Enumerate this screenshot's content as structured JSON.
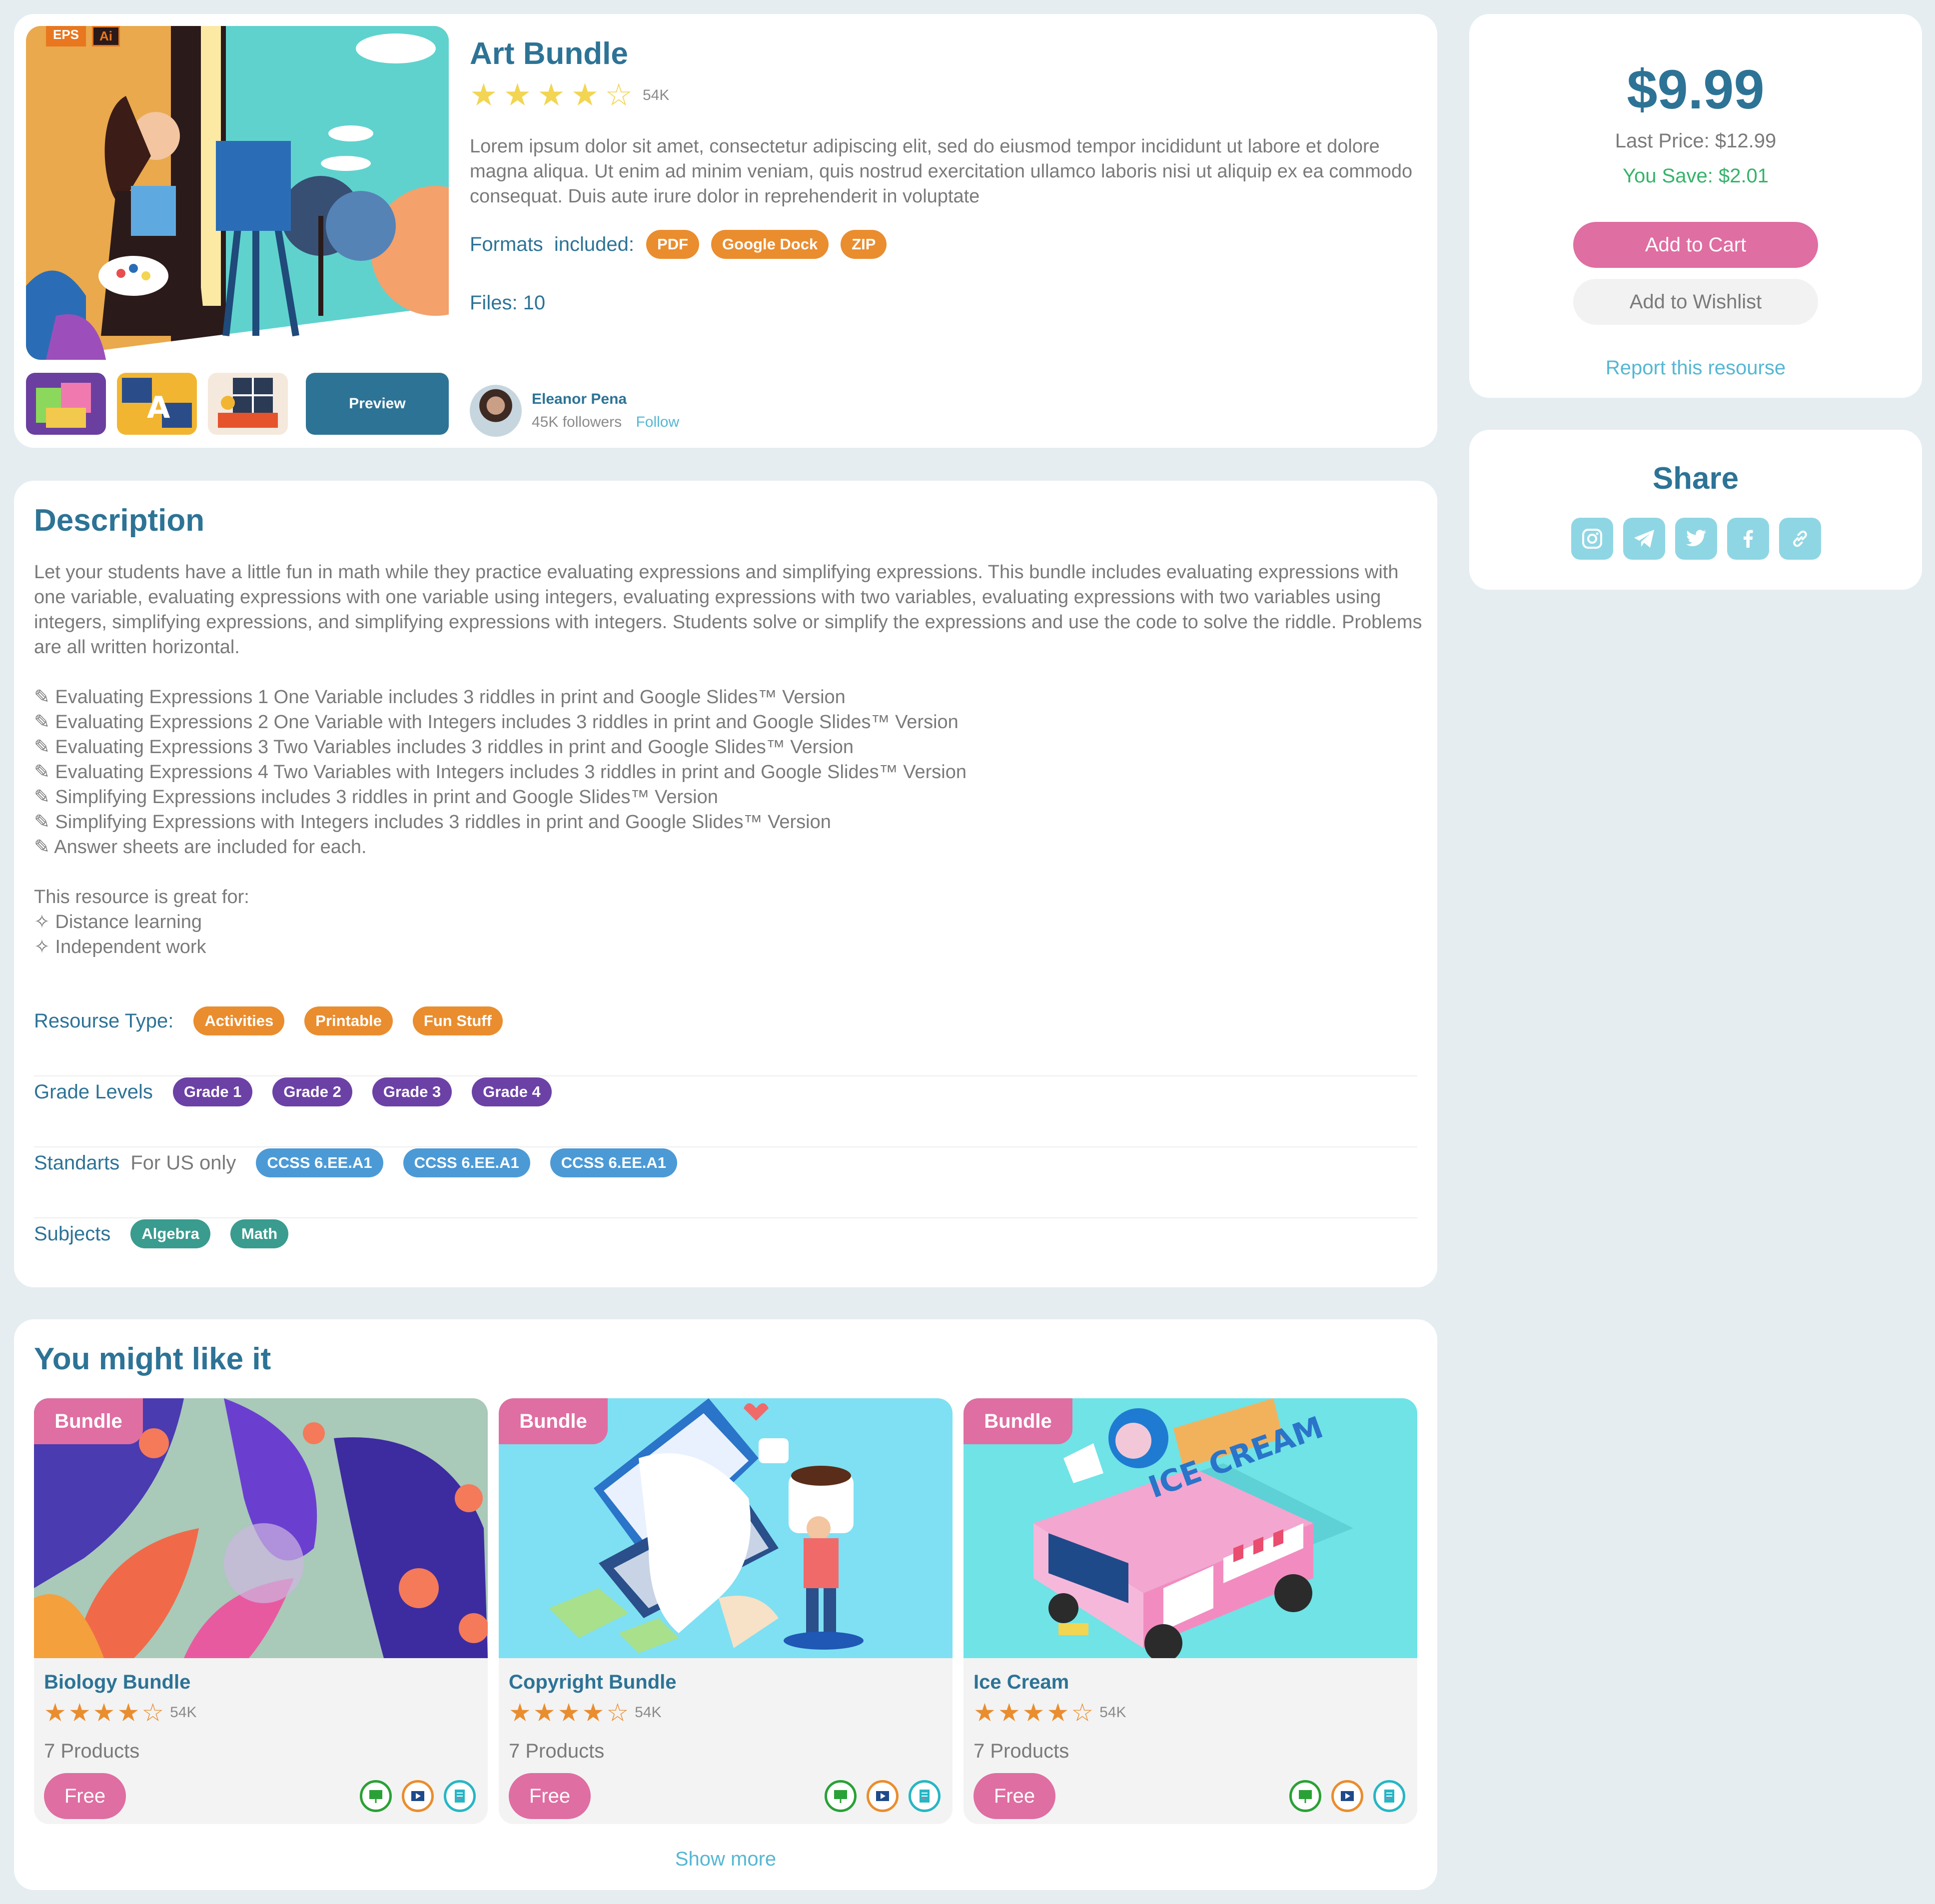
{
  "product": {
    "title": "Art Bundle",
    "rating": 4,
    "rating_count": "54K",
    "description": "Lorem ipsum dolor sit amet, consectetur adipiscing elit, sed do eiusmod tempor incididunt ut labore et dolore magna aliqua. Ut enim ad minim veniam, quis nostrud exercitation ullamco laboris nisi ut aliquip ex ea commodo consequat. Duis aute irure dolor in reprehenderit in voluptate",
    "formats_label": "Formats  included:",
    "formats": [
      "PDF",
      "Google Dock",
      "ZIP"
    ],
    "files": "Files: 10",
    "image_tags": [
      "EPS",
      "Ai"
    ],
    "preview_label": "Preview",
    "author": {
      "name": "Eleanor Pena",
      "followers": "45K followers",
      "follow_label": "Follow"
    }
  },
  "pricing": {
    "price": "$9.99",
    "last_price": "Last Price: $12.99",
    "you_save": "You Save: $2.01",
    "add_to_cart": "Add to Cart",
    "add_to_wishlist": "Add to Wishlist",
    "report": "Report this resourse"
  },
  "share": {
    "title": "Share",
    "icons": [
      "instagram-icon",
      "telegram-icon",
      "twitter-icon",
      "facebook-icon",
      "link-icon"
    ]
  },
  "description": {
    "title": "Description",
    "intro": "Let your students have a little fun in math while they practice evaluating expressions and simplifying expressions. This bundle includes evaluating expressions with one variable, evaluating expressions with one variable using integers, evaluating expressions with two variables, evaluating expressions with two variables using integers, simplifying expressions, and simplifying expressions with integers. Students solve or simplify the expressions and use the code to solve the riddle. Problems are all written horizontal.",
    "items": [
      "✎ Evaluating Expressions 1 One Variable includes 3 riddles in print and Google Slides™ Version",
      "✎ Evaluating Expressions 2 One Variable with Integers includes 3 riddles in print and Google Slides™ Version",
      "✎ Evaluating Expressions 3 Two Variables includes 3 riddles in print and Google Slides™ Version",
      "✎ Evaluating Expressions 4 Two Variables with Integers includes 3 riddles in print and Google Slides™ Version",
      "✎ Simplifying Expressions includes 3 riddles in print and Google Slides™ Version",
      "✎ Simplifying Expressions with Integers includes 3 riddles in print and Google Slides™ Version",
      "✎ Answer sheets are included for each."
    ],
    "great_for_label": "This resource is great for:",
    "great_for": [
      "✧ Distance learning",
      "✧ Independent work"
    ],
    "resource_type_label": "Resourse Type:",
    "resource_types": [
      "Activities",
      "Printable",
      "Fun Stuff"
    ],
    "grade_label": "Grade Levels",
    "grades": [
      "Grade 1",
      "Grade 2",
      "Grade 3",
      "Grade 4"
    ],
    "standards_label": "Standarts",
    "standards_note": "For US only",
    "standards": [
      "CCSS 6.EE.A1",
      "CCSS 6.EE.A1",
      "CCSS 6.EE.A1"
    ],
    "subjects_label": "Subjects",
    "subjects": [
      "Algebra",
      "Math"
    ]
  },
  "recommendations": {
    "title": "You might like it",
    "show_more": "Show more",
    "items": [
      {
        "badge": "Bundle",
        "title": "Biology Bundle",
        "rating": 4,
        "rating_count": "54K",
        "products": "7 Products",
        "price": "Free"
      },
      {
        "badge": "Bundle",
        "title": "Copyright Bundle",
        "rating": 4,
        "rating_count": "54K",
        "products": "7 Products",
        "price": "Free"
      },
      {
        "badge": "Bundle",
        "title": "Ice Cream",
        "rating": 4,
        "rating_count": "54K",
        "products": "7 Products",
        "price": "Free"
      }
    ],
    "item_icons": [
      "presentation-icon",
      "video-icon",
      "worksheet-icon"
    ],
    "icon_colors": [
      "#2aa136",
      "#ea8d2e",
      "#27b6c4"
    ]
  },
  "colors": {
    "primary": "#2d7396",
    "pink": "#df6ea2",
    "orange": "#ea8d2e",
    "purple": "#6c41a6",
    "blue": "#4b9ad6",
    "teal": "#3a9b8f",
    "green": "#36b36a",
    "link": "#55b7d2"
  }
}
